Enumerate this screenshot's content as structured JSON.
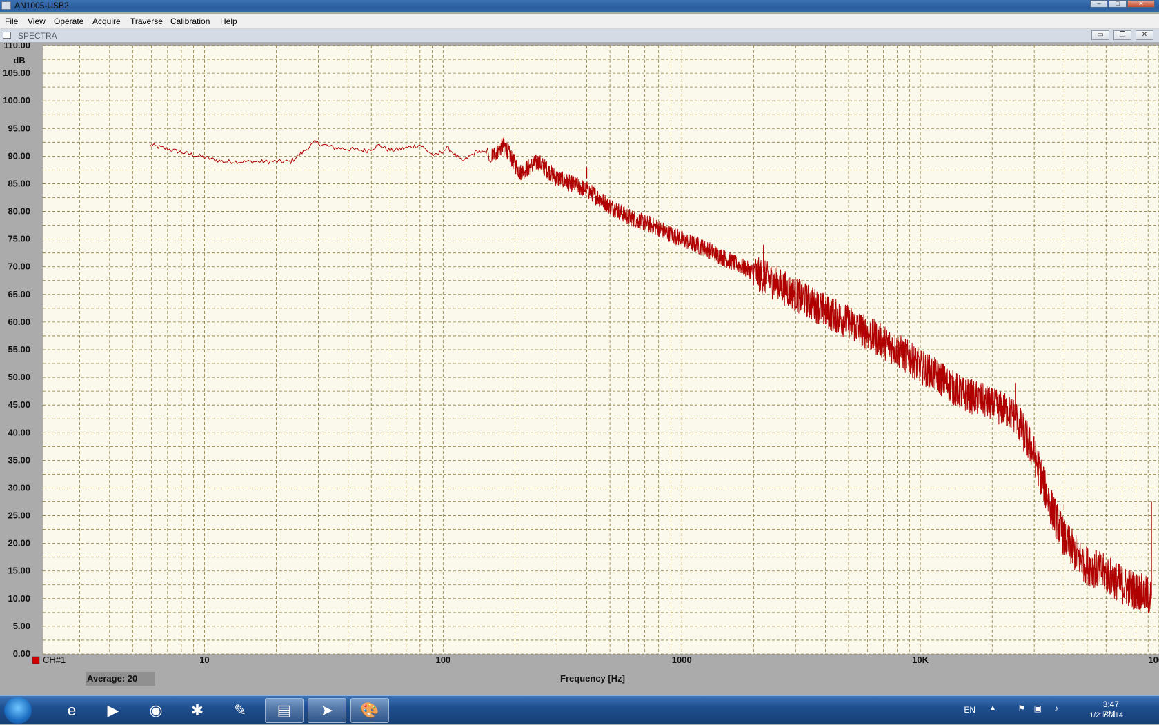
{
  "window": {
    "title": "AN1005-USB2"
  },
  "menu": {
    "items": [
      {
        "label": "File",
        "x": 7
      },
      {
        "label": "View",
        "x": 40
      },
      {
        "label": "Operate",
        "x": 78
      },
      {
        "label": "Acquire",
        "x": 134
      },
      {
        "label": "Traverse",
        "x": 189
      },
      {
        "label": "Calibration",
        "x": 247
      },
      {
        "label": "Help",
        "x": 319
      }
    ]
  },
  "document": {
    "title": "SPECTRA",
    "minimize_glyph": "▭",
    "restore_glyph": "❐",
    "close_glyph": "✕"
  },
  "status": {
    "average": "Average: 20"
  },
  "taskbar": {
    "language": "EN",
    "time": "3:47 PM",
    "date": "1/21/2014",
    "apps": [
      {
        "icon": "internet-explorer-icon",
        "glyph": "e",
        "active": false
      },
      {
        "icon": "media-player-icon",
        "glyph": "▶",
        "active": false
      },
      {
        "icon": "chrome-icon",
        "glyph": "◉",
        "active": false
      },
      {
        "icon": "ladybug-icon",
        "glyph": "✱",
        "active": false
      },
      {
        "icon": "tools-icon",
        "glyph": "✎",
        "active": false
      },
      {
        "icon": "file-explorer-icon",
        "glyph": "▤",
        "active": true
      },
      {
        "icon": "analyzer-app-icon",
        "glyph": "➤",
        "active": true
      },
      {
        "icon": "paint-icon",
        "glyph": "🎨",
        "active": true
      }
    ]
  },
  "chart_data": {
    "type": "line",
    "ylabel": "dB",
    "xlabel": "Frequency [Hz]",
    "x_scale": "log",
    "xlim": [
      2.1,
      100000
    ],
    "ylim": [
      0,
      110
    ],
    "yticks": [
      0,
      5,
      10,
      15,
      20,
      25,
      30,
      35,
      40,
      45,
      50,
      55,
      60,
      65,
      70,
      75,
      80,
      85,
      90,
      95,
      100,
      105,
      110
    ],
    "ytick_labels": [
      "0.00",
      "5.00",
      "10.00",
      "15.00",
      "20.00",
      "25.00",
      "30.00",
      "35.00",
      "40.00",
      "45.00",
      "50.00",
      "55.00",
      "60.00",
      "65.00",
      "70.00",
      "75.00",
      "80.00",
      "85.00",
      "90.00",
      "95.00",
      "100.00",
      "105.00",
      "110.00"
    ],
    "xticks": [
      10,
      100,
      1000,
      10000,
      100000
    ],
    "xtick_labels": [
      "10",
      "100",
      "1000",
      "10K",
      "100K"
    ],
    "grid": true,
    "legend": "bottom-left",
    "color": "#cc0000",
    "series": [
      {
        "name": "CH#1",
        "x": [
          5.9,
          12,
          23,
          29,
          35,
          48,
          54,
          60,
          70,
          80,
          92,
          105,
          120,
          140,
          160,
          180,
          210,
          250,
          300,
          400,
          500,
          600,
          800,
          1000,
          1300,
          1600,
          2000,
          2500,
          3000,
          4000,
          5000,
          6000,
          8000,
          10000,
          12000,
          15000,
          18000,
          20000,
          23000,
          25000,
          30000,
          35000,
          40000,
          45000,
          50000,
          60000,
          70000,
          80000,
          90000,
          93000
        ],
        "y": [
          92,
          89,
          89,
          92.5,
          91.5,
          91,
          92,
          91,
          91.5,
          92,
          90,
          91.5,
          89,
          91,
          90,
          92,
          87,
          89,
          86,
          84,
          81,
          79,
          77,
          75,
          73,
          71,
          69,
          67,
          65,
          62,
          60,
          58,
          55,
          52,
          50,
          47,
          46,
          45,
          44,
          43,
          36,
          27,
          21,
          18,
          16,
          14.5,
          12.5,
          11.5,
          10.5,
          10
        ],
        "spikes": [
          {
            "x": 180,
            "y": 93
          },
          {
            "x": 400,
            "y": 88
          },
          {
            "x": 2200,
            "y": 74
          },
          {
            "x": 25000,
            "y": 49
          },
          {
            "x": 40000,
            "y": 26
          },
          {
            "x": 93000,
            "y": 27.5
          }
        ]
      }
    ]
  }
}
